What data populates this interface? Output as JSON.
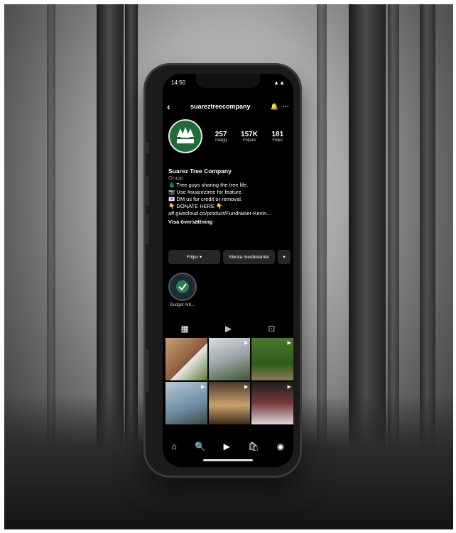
{
  "status": {
    "time": "14:50",
    "signal": "▲▲",
    "battery": "▮"
  },
  "header": {
    "username": "suareztreecompany",
    "back_icon": "‹",
    "bell_icon": "🔔",
    "more_icon": "···"
  },
  "profile": {
    "avatar_text": "SUAREZ TREE",
    "stats": [
      {
        "value": "257",
        "label": "Inlägg"
      },
      {
        "value": "157K",
        "label": "Följare"
      },
      {
        "value": "181",
        "label": "Följer"
      }
    ],
    "name": "Suarez Tree Company",
    "category": "Grupp",
    "bio_lines": [
      "🌲 Tree guys sharing the tree life.",
      "📷 Use #suareztree for feature.",
      "💌 DM us for credit or removal.",
      "👇 DONATE HERE 👇",
      "aff.givecloud.co/product/Fundraiser-Kevin..."
    ],
    "translation": "Visa översättning"
  },
  "actions": {
    "follow": "Följer ▾",
    "message": "Skicka meddelande",
    "more": "▾"
  },
  "highlight": {
    "label": "Budget Arb..."
  },
  "tabs": {
    "grid": "▦",
    "reels": "▶",
    "tagged": "⊡"
  },
  "nav": {
    "home": "⌂",
    "search": "🔍",
    "reels": "▶",
    "shop": "🛍",
    "profile": "◉"
  },
  "colors": {
    "screen": "#000000",
    "brand_green": "#1f6b3a"
  }
}
